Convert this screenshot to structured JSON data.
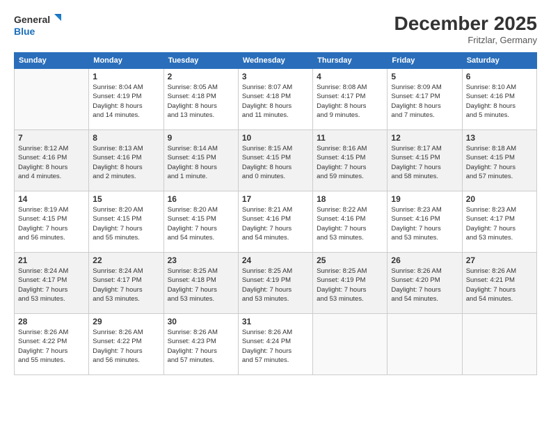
{
  "header": {
    "logo_line1": "General",
    "logo_line2": "Blue",
    "month": "December 2025",
    "location": "Fritzlar, Germany"
  },
  "days_of_week": [
    "Sunday",
    "Monday",
    "Tuesday",
    "Wednesday",
    "Thursday",
    "Friday",
    "Saturday"
  ],
  "weeks": [
    [
      {
        "day": "",
        "info": ""
      },
      {
        "day": "1",
        "info": "Sunrise: 8:04 AM\nSunset: 4:19 PM\nDaylight: 8 hours\nand 14 minutes."
      },
      {
        "day": "2",
        "info": "Sunrise: 8:05 AM\nSunset: 4:18 PM\nDaylight: 8 hours\nand 13 minutes."
      },
      {
        "day": "3",
        "info": "Sunrise: 8:07 AM\nSunset: 4:18 PM\nDaylight: 8 hours\nand 11 minutes."
      },
      {
        "day": "4",
        "info": "Sunrise: 8:08 AM\nSunset: 4:17 PM\nDaylight: 8 hours\nand 9 minutes."
      },
      {
        "day": "5",
        "info": "Sunrise: 8:09 AM\nSunset: 4:17 PM\nDaylight: 8 hours\nand 7 minutes."
      },
      {
        "day": "6",
        "info": "Sunrise: 8:10 AM\nSunset: 4:16 PM\nDaylight: 8 hours\nand 5 minutes."
      }
    ],
    [
      {
        "day": "7",
        "info": "Sunrise: 8:12 AM\nSunset: 4:16 PM\nDaylight: 8 hours\nand 4 minutes."
      },
      {
        "day": "8",
        "info": "Sunrise: 8:13 AM\nSunset: 4:16 PM\nDaylight: 8 hours\nand 2 minutes."
      },
      {
        "day": "9",
        "info": "Sunrise: 8:14 AM\nSunset: 4:15 PM\nDaylight: 8 hours\nand 1 minute."
      },
      {
        "day": "10",
        "info": "Sunrise: 8:15 AM\nSunset: 4:15 PM\nDaylight: 8 hours\nand 0 minutes."
      },
      {
        "day": "11",
        "info": "Sunrise: 8:16 AM\nSunset: 4:15 PM\nDaylight: 7 hours\nand 59 minutes."
      },
      {
        "day": "12",
        "info": "Sunrise: 8:17 AM\nSunset: 4:15 PM\nDaylight: 7 hours\nand 58 minutes."
      },
      {
        "day": "13",
        "info": "Sunrise: 8:18 AM\nSunset: 4:15 PM\nDaylight: 7 hours\nand 57 minutes."
      }
    ],
    [
      {
        "day": "14",
        "info": "Sunrise: 8:19 AM\nSunset: 4:15 PM\nDaylight: 7 hours\nand 56 minutes."
      },
      {
        "day": "15",
        "info": "Sunrise: 8:20 AM\nSunset: 4:15 PM\nDaylight: 7 hours\nand 55 minutes."
      },
      {
        "day": "16",
        "info": "Sunrise: 8:20 AM\nSunset: 4:15 PM\nDaylight: 7 hours\nand 54 minutes."
      },
      {
        "day": "17",
        "info": "Sunrise: 8:21 AM\nSunset: 4:16 PM\nDaylight: 7 hours\nand 54 minutes."
      },
      {
        "day": "18",
        "info": "Sunrise: 8:22 AM\nSunset: 4:16 PM\nDaylight: 7 hours\nand 53 minutes."
      },
      {
        "day": "19",
        "info": "Sunrise: 8:23 AM\nSunset: 4:16 PM\nDaylight: 7 hours\nand 53 minutes."
      },
      {
        "day": "20",
        "info": "Sunrise: 8:23 AM\nSunset: 4:17 PM\nDaylight: 7 hours\nand 53 minutes."
      }
    ],
    [
      {
        "day": "21",
        "info": "Sunrise: 8:24 AM\nSunset: 4:17 PM\nDaylight: 7 hours\nand 53 minutes."
      },
      {
        "day": "22",
        "info": "Sunrise: 8:24 AM\nSunset: 4:17 PM\nDaylight: 7 hours\nand 53 minutes."
      },
      {
        "day": "23",
        "info": "Sunrise: 8:25 AM\nSunset: 4:18 PM\nDaylight: 7 hours\nand 53 minutes."
      },
      {
        "day": "24",
        "info": "Sunrise: 8:25 AM\nSunset: 4:19 PM\nDaylight: 7 hours\nand 53 minutes."
      },
      {
        "day": "25",
        "info": "Sunrise: 8:25 AM\nSunset: 4:19 PM\nDaylight: 7 hours\nand 53 minutes."
      },
      {
        "day": "26",
        "info": "Sunrise: 8:26 AM\nSunset: 4:20 PM\nDaylight: 7 hours\nand 54 minutes."
      },
      {
        "day": "27",
        "info": "Sunrise: 8:26 AM\nSunset: 4:21 PM\nDaylight: 7 hours\nand 54 minutes."
      }
    ],
    [
      {
        "day": "28",
        "info": "Sunrise: 8:26 AM\nSunset: 4:22 PM\nDaylight: 7 hours\nand 55 minutes."
      },
      {
        "day": "29",
        "info": "Sunrise: 8:26 AM\nSunset: 4:22 PM\nDaylight: 7 hours\nand 56 minutes."
      },
      {
        "day": "30",
        "info": "Sunrise: 8:26 AM\nSunset: 4:23 PM\nDaylight: 7 hours\nand 57 minutes."
      },
      {
        "day": "31",
        "info": "Sunrise: 8:26 AM\nSunset: 4:24 PM\nDaylight: 7 hours\nand 57 minutes."
      },
      {
        "day": "",
        "info": ""
      },
      {
        "day": "",
        "info": ""
      },
      {
        "day": "",
        "info": ""
      }
    ]
  ]
}
